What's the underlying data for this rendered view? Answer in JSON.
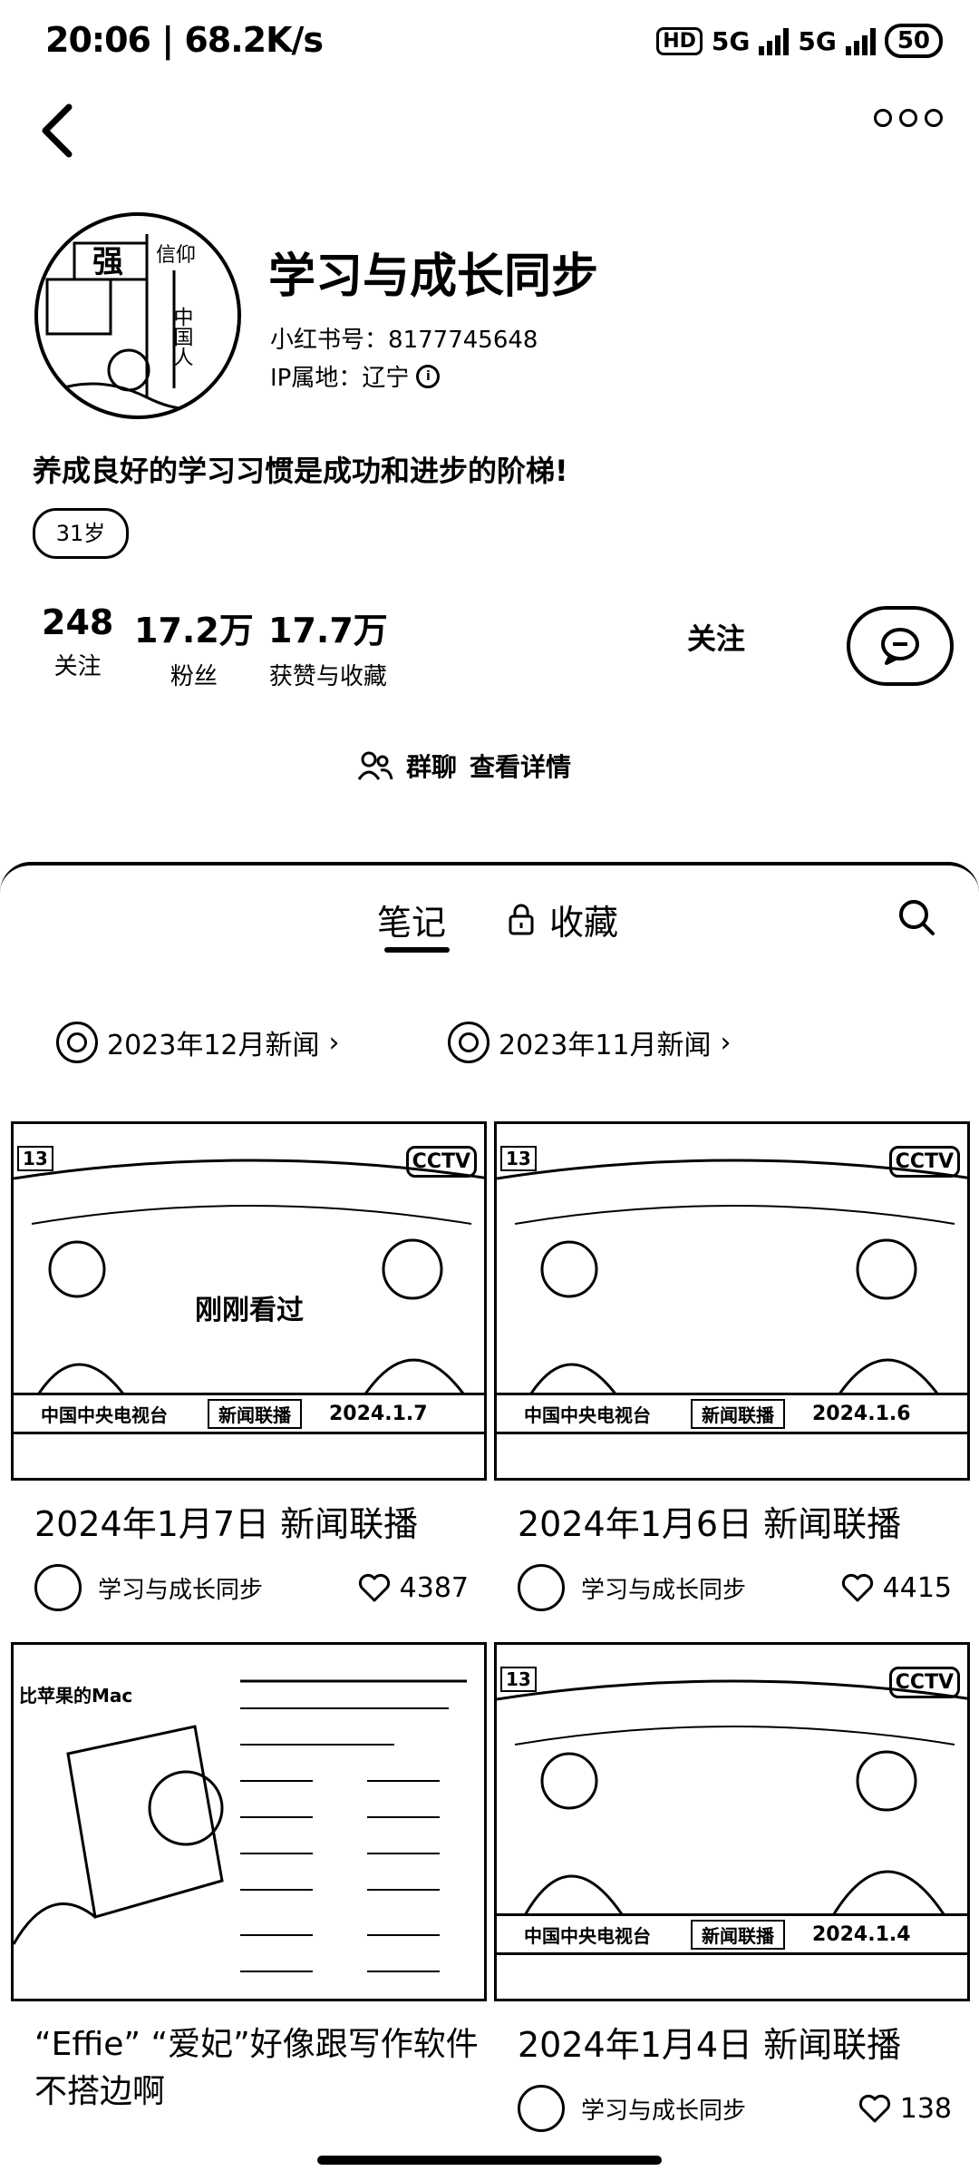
{
  "status": {
    "time": "20:06",
    "speed": "68.2K/s",
    "hd": "HD",
    "net1": "5G",
    "net2": "5G",
    "battery": "50"
  },
  "profile": {
    "nickname": "学习与成长同步",
    "id_label": "小红书号",
    "id_value": "8177745648",
    "ip_label": "IP属地",
    "ip_value": "辽宁",
    "bio": "养成良好的学习习惯是成功和进步的阶梯!",
    "age_tag": "31岁",
    "avatar_text": [
      "强",
      "信仰",
      "中国人"
    ]
  },
  "stats": [
    {
      "num": "248",
      "label": "关注"
    },
    {
      "num": "17.2万",
      "label": "粉丝"
    },
    {
      "num": "17.7万",
      "label": "获赞与收藏"
    }
  ],
  "actions": {
    "follow": "关注",
    "group_chat": "群聊",
    "view_detail": "查看详情"
  },
  "tabs": {
    "notes": "笔记",
    "collect": "收藏"
  },
  "collections": [
    {
      "label": "2023年12月新闻"
    },
    {
      "label": "2023年11月新闻"
    }
  ],
  "cards": [
    {
      "title": "2024年1月7日 新闻联播",
      "author": "学习与成长同步",
      "likes": "4387",
      "channel": "中国中央电视台",
      "program": "新闻联播",
      "date": "2024.1.7",
      "badge": "刚刚看过",
      "cctv": "CCTV",
      "chno": "13"
    },
    {
      "title": "2024年1月6日 新闻联播",
      "author": "学习与成长同步",
      "likes": "4415",
      "channel": "中国中央电视台",
      "program": "新闻联播",
      "date": "2024.1.6",
      "cctv": "CCTV",
      "chno": "13"
    },
    {
      "title": "“Effie” “爱妃”好像跟写作软件不搭边啊",
      "mac_label": "比苹果的Mac"
    },
    {
      "title": "2024年1月4日 新闻联播",
      "author": "学习与成长同步",
      "likes": "138",
      "channel": "中国中央电视台",
      "program": "新闻联播",
      "date": "2024.1.4",
      "cctv": "CCTV",
      "chno": "13"
    }
  ]
}
